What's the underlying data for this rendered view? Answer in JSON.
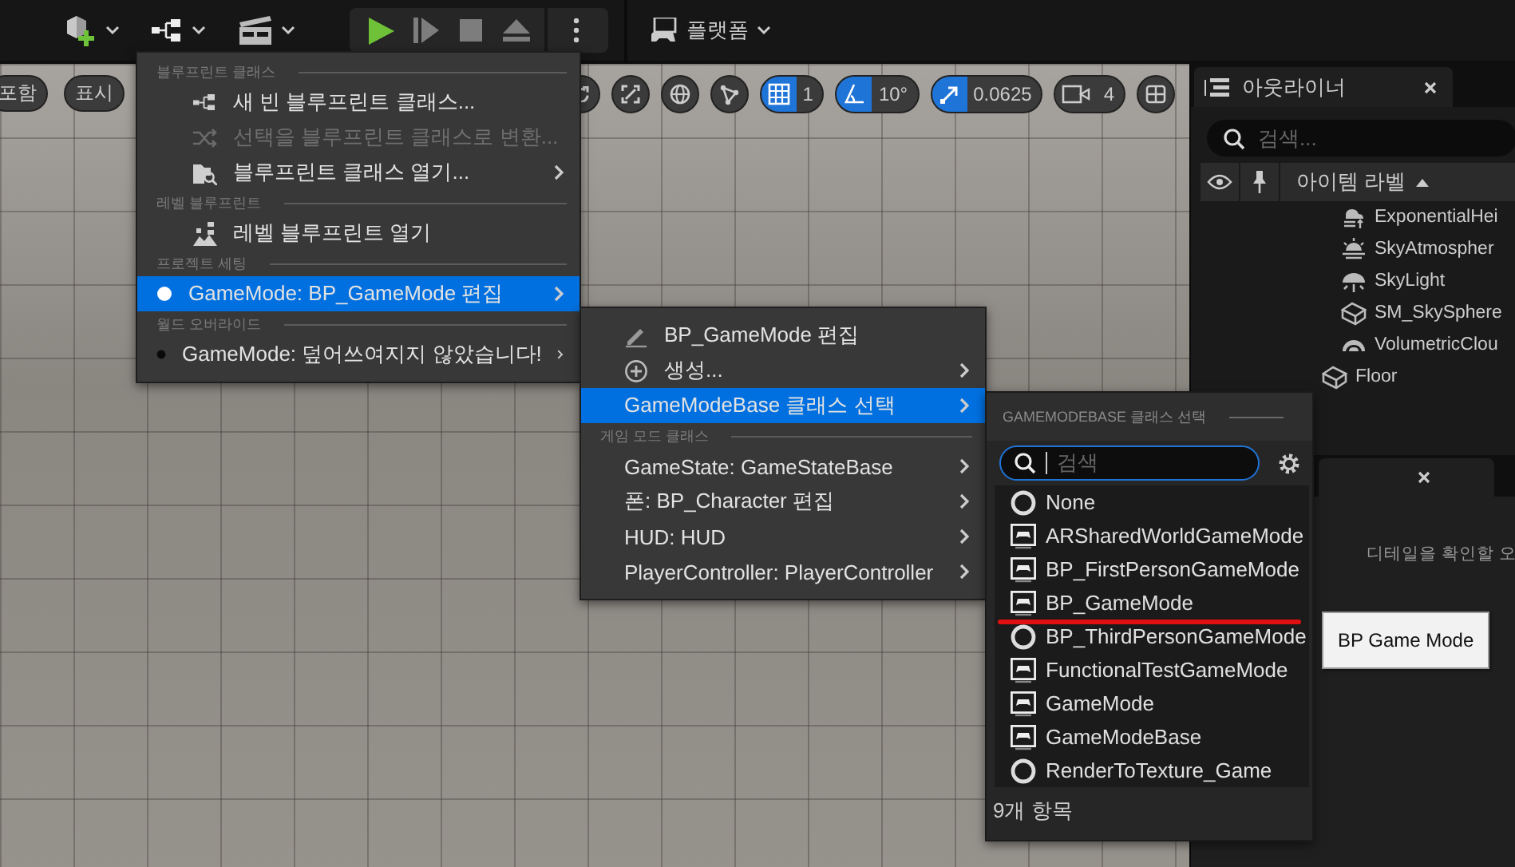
{
  "toolbar": {
    "platform_label": "플랫폼"
  },
  "viewport": {
    "left_buttons": [
      "포함",
      "표시"
    ],
    "grid_snap": {
      "on": true,
      "value": "1"
    },
    "rotation_snap": {
      "on": true,
      "value": "10°"
    },
    "scale_snap": {
      "on": true,
      "value": "0.0625"
    },
    "camera_speed": "4"
  },
  "outliner": {
    "title": "아웃라이너",
    "search_placeholder": "검색...",
    "column_label": "아이템 라벨",
    "items": [
      {
        "kind": "group",
        "children": [
          {
            "label": "ExponentialHei",
            "kind": "fog"
          },
          {
            "label": "SkyAtmospher",
            "kind": "sun"
          },
          {
            "label": "SkyLight",
            "kind": "skylight"
          },
          {
            "label": "SM_SkySphere",
            "kind": "mesh"
          },
          {
            "label": "VolumetricClou",
            "kind": "cloud"
          }
        ]
      },
      {
        "label": "Floor",
        "kind": "mesh"
      }
    ]
  },
  "details": {
    "hint": "디테일을 확인할 오"
  },
  "main_menu": {
    "sections": [
      {
        "heading": "블루프린트 클래스",
        "items": [
          {
            "label": "새 빈 블루프린트 클래스...",
            "kind": "new-blueprint",
            "disabled": false,
            "submenu": false,
            "selected": false
          },
          {
            "label": "선택을 블루프린트 클래스로 변환...",
            "kind": "convert",
            "disabled": true,
            "submenu": false,
            "selected": false
          },
          {
            "label": "블루프린트 클래스 열기...",
            "kind": "open-blueprint",
            "disabled": false,
            "submenu": true,
            "selected": false
          }
        ]
      },
      {
        "heading": "레벨 블루프린트",
        "items": [
          {
            "label": "레벨 블루프린트 열기",
            "kind": "level-blueprint",
            "disabled": false,
            "submenu": false,
            "selected": false
          }
        ]
      },
      {
        "heading": "프로젝트 세팅",
        "items": [
          {
            "label": "GameMode: BP_GameMode 편집",
            "kind": "dot",
            "set": true,
            "disabled": false,
            "submenu": true,
            "selected": true
          }
        ]
      },
      {
        "heading": "월드 오버라이드",
        "items": [
          {
            "label": "GameMode: 덮어쓰여지지 않았습니다!",
            "kind": "dot",
            "set": false,
            "disabled": false,
            "submenu": true,
            "selected": false
          }
        ]
      }
    ]
  },
  "gamemode_menu": {
    "sections": [
      {
        "items": [
          {
            "label": "BP_GameMode 편집",
            "kind": "edit",
            "disabled": false,
            "submenu": false,
            "selected": false
          },
          {
            "label": "생성...",
            "kind": "create",
            "disabled": false,
            "submenu": true,
            "selected": false
          },
          {
            "label": "GameModeBase 클래스 선택",
            "kind": "plain",
            "disabled": false,
            "submenu": true,
            "selected": true
          }
        ]
      },
      {
        "heading": "게임 모드 클래스",
        "items": [
          {
            "label": "GameState: GameStateBase",
            "kind": "plain",
            "disabled": false,
            "submenu": true,
            "selected": false
          },
          {
            "label": "폰: BP_Character 편집",
            "kind": "plain",
            "disabled": false,
            "submenu": true,
            "selected": false
          },
          {
            "label": "HUD: HUD",
            "kind": "plain",
            "disabled": false,
            "submenu": true,
            "selected": false
          },
          {
            "label": "PlayerController: PlayerController",
            "kind": "plain",
            "disabled": false,
            "submenu": true,
            "selected": false
          }
        ]
      }
    ]
  },
  "class_picker": {
    "heading": "GAMEMODEBASE 클래스 선택",
    "search_placeholder": "검색",
    "classes": [
      {
        "label": "None",
        "kind": "none",
        "underlined": false
      },
      {
        "label": "ARSharedWorldGameMode",
        "kind": "blueprint",
        "underlined": false
      },
      {
        "label": "BP_FirstPersonGameMode",
        "kind": "blueprint",
        "underlined": false
      },
      {
        "label": "BP_GameMode",
        "kind": "blueprint",
        "underlined": true
      },
      {
        "label": "BP_ThirdPersonGameMode",
        "kind": "none",
        "underlined": false
      },
      {
        "label": "FunctionalTestGameMode",
        "kind": "blueprint",
        "underlined": false
      },
      {
        "label": "GameMode",
        "kind": "blueprint",
        "underlined": false
      },
      {
        "label": "GameModeBase",
        "kind": "blueprint",
        "underlined": false
      },
      {
        "label": "RenderToTexture_Game",
        "kind": "none",
        "underlined": false
      }
    ],
    "count": "9개 항목"
  },
  "tooltip": {
    "text": "BP Game Mode"
  }
}
